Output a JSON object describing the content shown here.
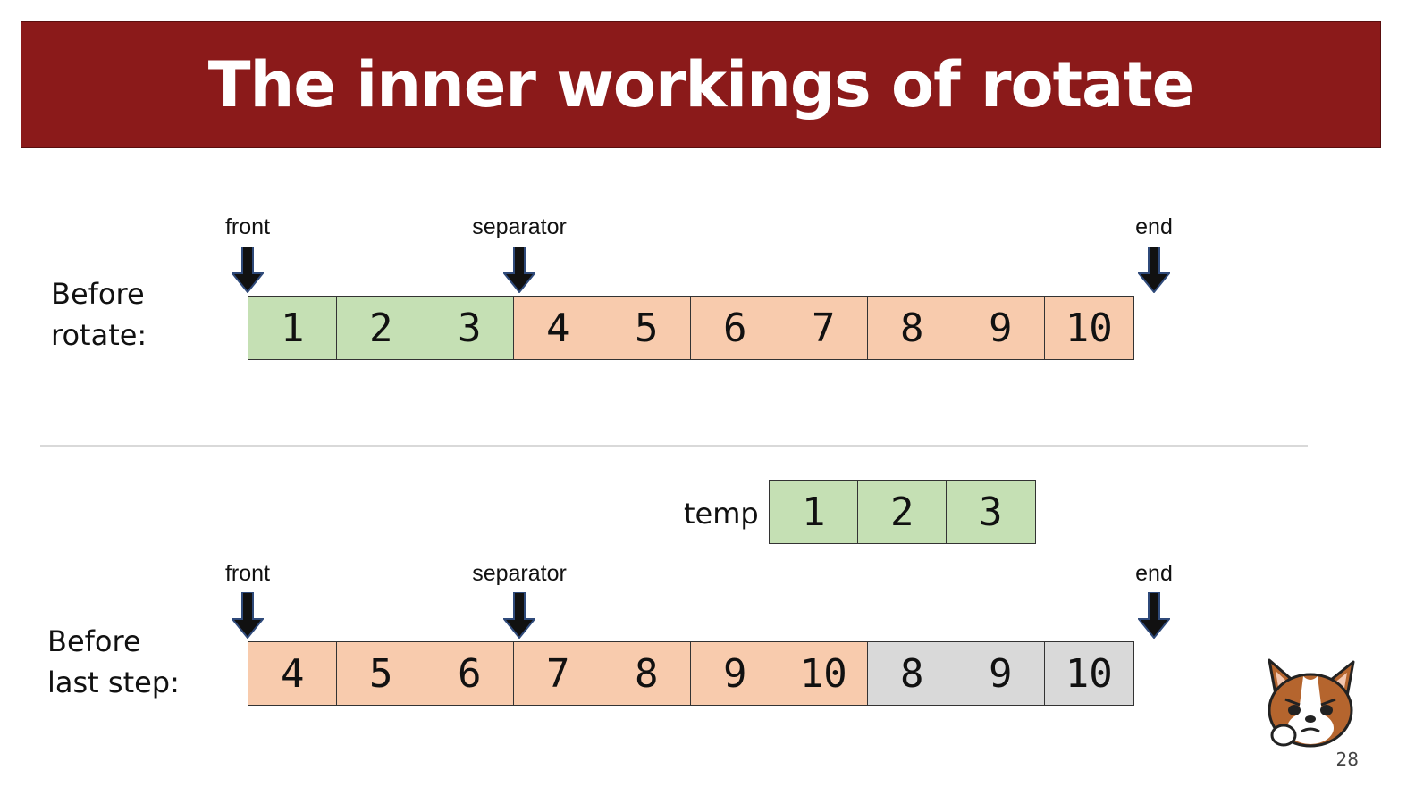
{
  "slide": {
    "title": "The inner workings of rotate",
    "page_number": "28"
  },
  "colors": {
    "title_bg": "#8b1a1a",
    "green": "#c5e0b4",
    "peach": "#f8cbad",
    "gray": "#d9d9d9"
  },
  "diagrams": [
    {
      "label": "Before\nrotate:",
      "pointers": [
        {
          "label": "front"
        },
        {
          "label": "separator"
        },
        {
          "label": "end"
        }
      ],
      "cells": [
        {
          "value": "1",
          "color": "#c5e0b4"
        },
        {
          "value": "2",
          "color": "#c5e0b4"
        },
        {
          "value": "3",
          "color": "#c5e0b4"
        },
        {
          "value": "4",
          "color": "#f8cbad"
        },
        {
          "value": "5",
          "color": "#f8cbad"
        },
        {
          "value": "6",
          "color": "#f8cbad"
        },
        {
          "value": "7",
          "color": "#f8cbad"
        },
        {
          "value": "8",
          "color": "#f8cbad"
        },
        {
          "value": "9",
          "color": "#f8cbad"
        },
        {
          "value": "10",
          "color": "#f8cbad"
        }
      ]
    },
    {
      "label": "Before\nlast step:",
      "pointers": [
        {
          "label": "front"
        },
        {
          "label": "separator"
        },
        {
          "label": "end"
        }
      ],
      "cells": [
        {
          "value": "4",
          "color": "#f8cbad"
        },
        {
          "value": "5",
          "color": "#f8cbad"
        },
        {
          "value": "6",
          "color": "#f8cbad"
        },
        {
          "value": "7",
          "color": "#f8cbad"
        },
        {
          "value": "8",
          "color": "#f8cbad"
        },
        {
          "value": "9",
          "color": "#f8cbad"
        },
        {
          "value": "10",
          "color": "#f8cbad"
        },
        {
          "value": "8",
          "color": "#d9d9d9"
        },
        {
          "value": "9",
          "color": "#d9d9d9"
        },
        {
          "value": "10",
          "color": "#d9d9d9"
        }
      ]
    }
  ],
  "temp": {
    "label": "temp",
    "cells": [
      {
        "value": "1",
        "color": "#c5e0b4"
      },
      {
        "value": "2",
        "color": "#c5e0b4"
      },
      {
        "value": "3",
        "color": "#c5e0b4"
      }
    ]
  },
  "icons": {
    "pointer_arrow": "down-arrow-icon",
    "mascot": "corgi-mascot-icon"
  }
}
